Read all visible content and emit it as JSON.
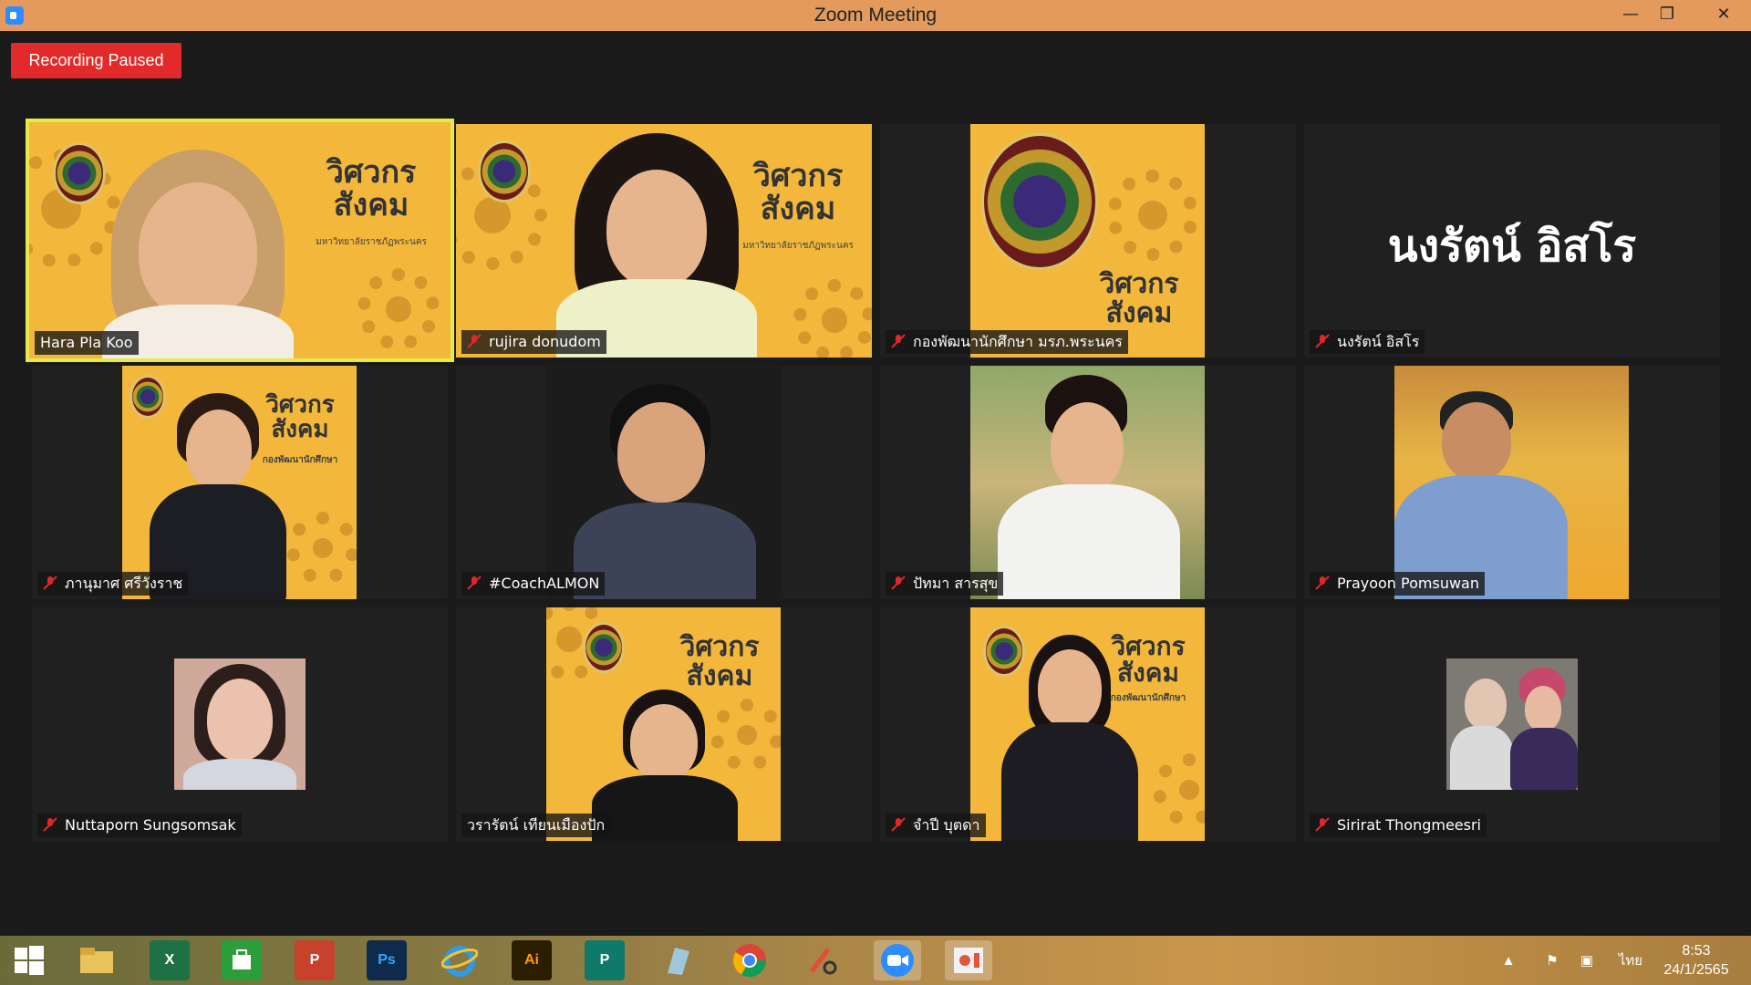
{
  "window": {
    "title": "Zoom Meeting",
    "minimize": "—",
    "maximize": "❐",
    "close": "✕"
  },
  "recording_label": "Recording Paused",
  "participants": [
    {
      "name": "Hara Pla Koo",
      "muted": false,
      "active_speaker": true
    },
    {
      "name": "rujira donudom",
      "muted": true
    },
    {
      "name": "กองพัฒนานักศึกษา มรภ.พระนคร",
      "muted": true
    },
    {
      "name": "นงรัตน์ อิสโร",
      "muted": true,
      "display_text": "นงรัตน์ อิสโร"
    },
    {
      "name": "ภานุมาศ ศรีวังราช",
      "muted": true
    },
    {
      "name": "#CoachALMON",
      "muted": true
    },
    {
      "name": "ปัทมา สารสุข",
      "muted": true
    },
    {
      "name": "Prayoon Pomsuwan",
      "muted": true
    },
    {
      "name": "Nuttaporn Sungsomsak",
      "muted": true
    },
    {
      "name": "วรารัตน์ เทียนเมืองปัก",
      "muted": false
    },
    {
      "name": "จำปี บุตดา",
      "muted": true
    },
    {
      "name": "Sirirat Thongmeesri",
      "muted": true
    }
  ],
  "background_logo": {
    "title_line1": "วิศวกร",
    "title_line2": "สังคม",
    "subtitle": "มหาวิทยาลัยราชภัฏพระนคร",
    "subtitle_alt": "กองพัฒนานักศึกษา"
  },
  "taskbar": {
    "apps": [
      "start-icon",
      "file-explorer-icon",
      "excel-icon",
      "store-icon",
      "powerpoint-icon",
      "photoshop-icon",
      "internet-explorer-icon",
      "illustrator-icon",
      "publisher-icon",
      "app-icon",
      "chrome-icon",
      "snipping-icon",
      "zoom-icon",
      "slides-icon"
    ],
    "labels": {
      "excel": "X",
      "photoshop": "Ps",
      "illustrator": "Ai",
      "powerpoint": "P",
      "publisher": "P"
    },
    "language": "ไทย",
    "time": "8:53",
    "date": "24/1/2565"
  },
  "colors": {
    "recording": "#e32a2a",
    "active_border": "#e7e84a",
    "titlebar": "#e39a5c",
    "virtual_bg": "#f3b83b",
    "zoom_blue": "#2d8cff"
  }
}
